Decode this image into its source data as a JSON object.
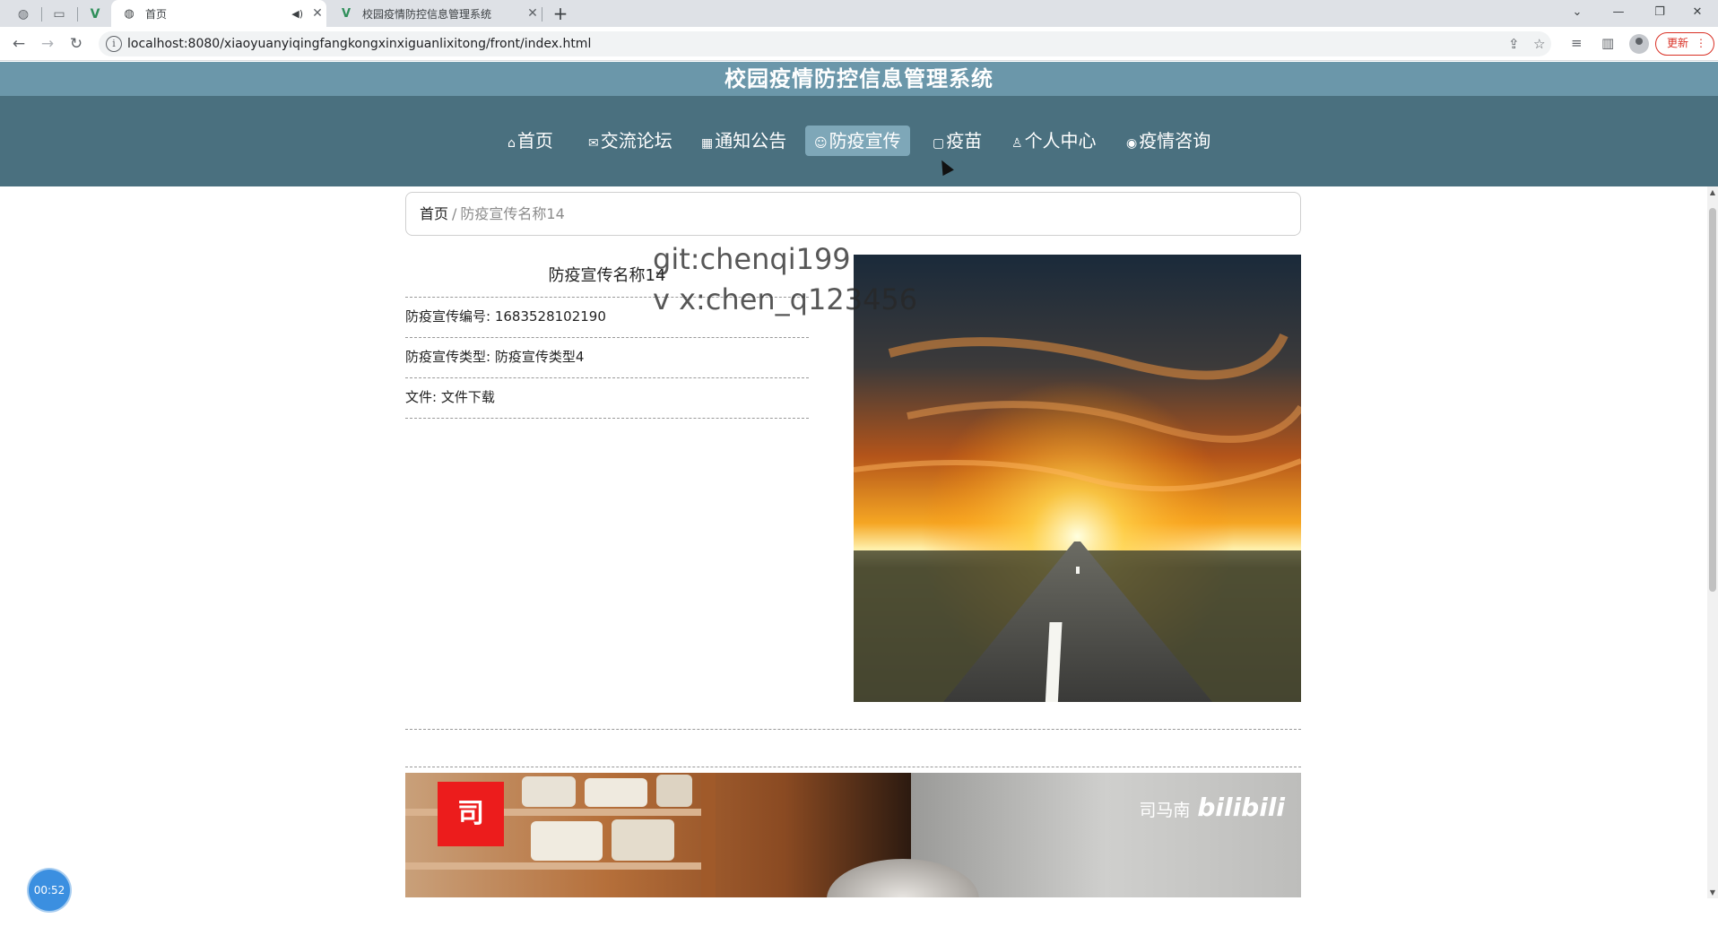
{
  "browser": {
    "tabs": [
      {
        "label": "首页",
        "active": true
      },
      {
        "label": "校园疫情防控信息管理系统",
        "active": false
      }
    ],
    "new_tab": "+",
    "url": "localhost:8080/xiaoyuanyiqingfangkongxinxiguanlixitong/front/index.html",
    "update_label": "更新",
    "menu_dots": "⋮"
  },
  "site": {
    "title": "校园疫情防控信息管理系统",
    "nav": [
      {
        "icon": "⌂",
        "label": "首页"
      },
      {
        "icon": "✉",
        "label": "交流论坛"
      },
      {
        "icon": "▦",
        "label": "通知公告"
      },
      {
        "icon": "☺",
        "label": "防疫宣传"
      },
      {
        "icon": "▢",
        "label": "疫苗"
      },
      {
        "icon": "♙",
        "label": "个人中心"
      },
      {
        "icon": "◉",
        "label": "疫情咨询"
      }
    ],
    "active_nav": "防疫宣传"
  },
  "breadcrumb": {
    "home": "首页",
    "separator": "/",
    "current": "防疫宣传名称14"
  },
  "detail": {
    "title": "防疫宣传名称14",
    "code_label": "防疫宣传编号: 1683528102190",
    "type_label": "防疫宣传类型: 防疫宣传类型4",
    "file_label": "文件: ",
    "file_link": "文件下载"
  },
  "watermark": {
    "line1": "git:chenqi199",
    "line2": "v x:chen_q123456"
  },
  "video": {
    "logo_char": "司",
    "brand": "司马南",
    "bili": "bilibili"
  },
  "timer": "00:52",
  "colors": {
    "title_bar": "#6b97aa",
    "nav_bar": "#4a707f",
    "nav_active": "#7ea7b8",
    "timer": "#3b8fe0",
    "update": "#d93025"
  }
}
